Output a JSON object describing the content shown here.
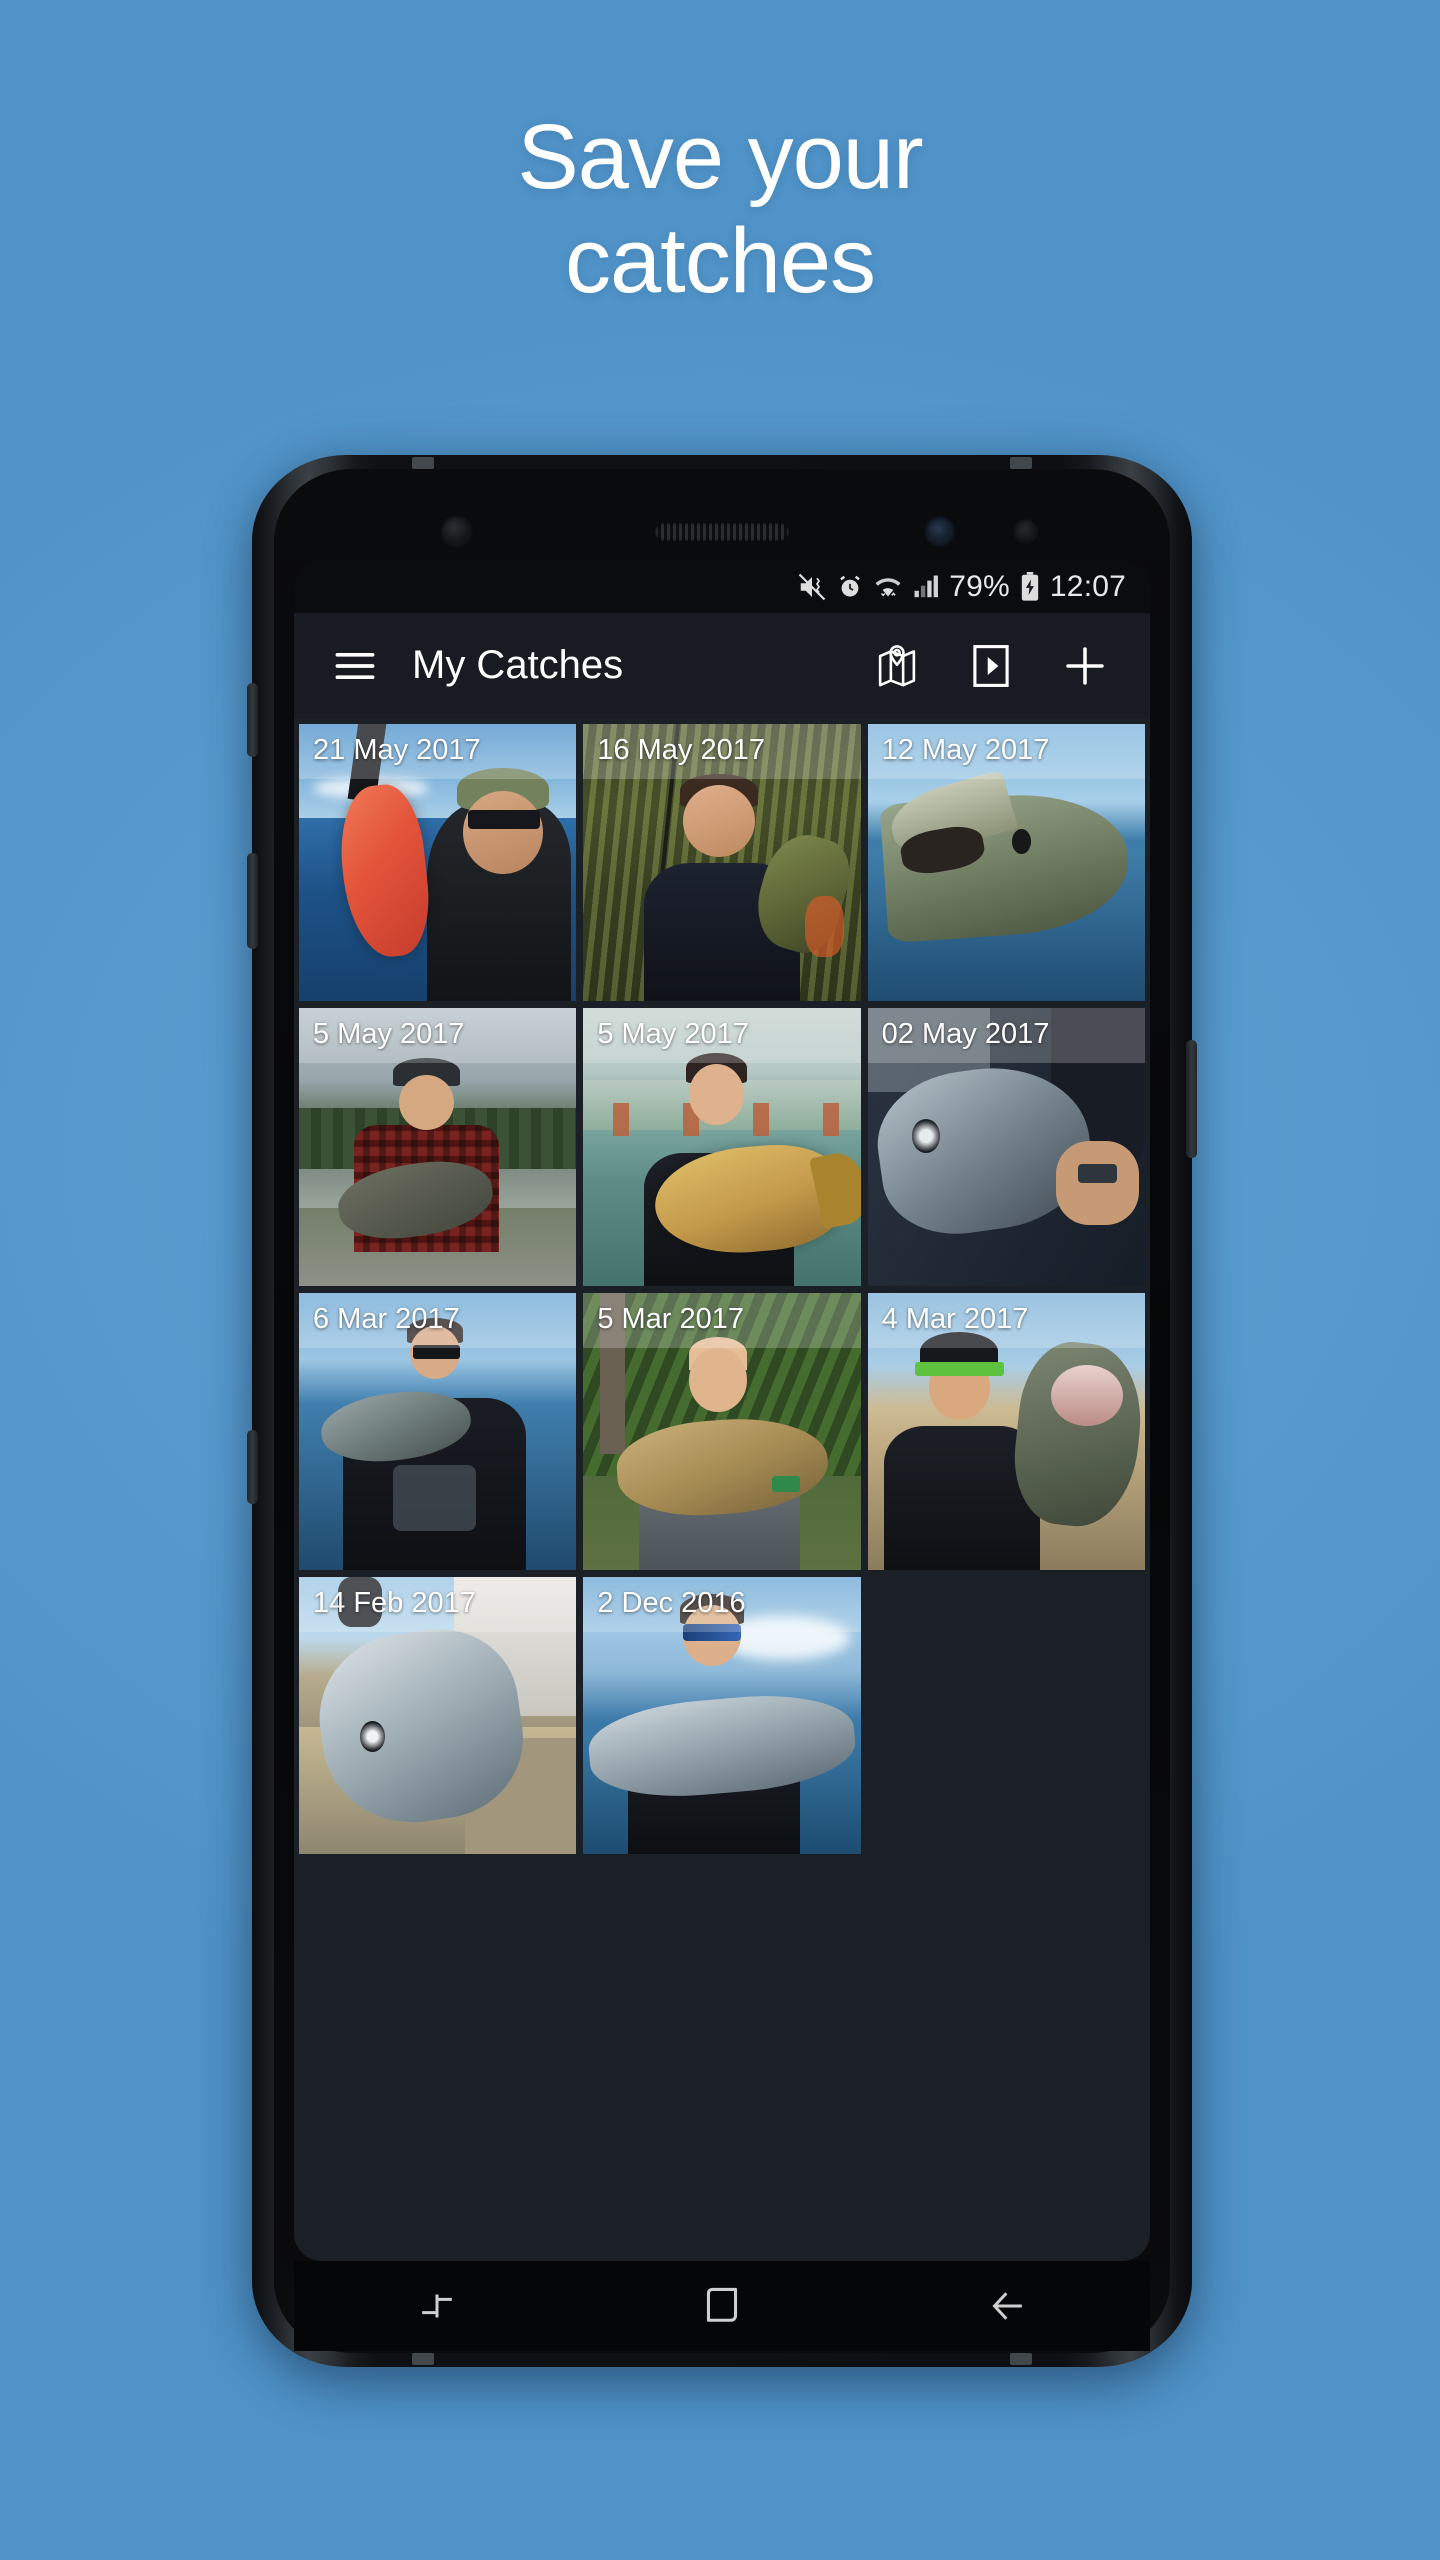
{
  "promo": {
    "headline_line1": "Save your",
    "headline_line2": "catches",
    "background_color": "#5a9ed1"
  },
  "device": {
    "frame": "samsung-galaxy-s8",
    "statusbar": {
      "icons": [
        "mute-vibrate-icon",
        "alarm-icon",
        "wifi-icon",
        "signal-icon",
        "battery-charging-icon"
      ],
      "battery_percent": "79%",
      "time": "12:07"
    },
    "navbar": {
      "recents_label": "recents-icon",
      "home_label": "home-icon",
      "back_label": "back-icon"
    }
  },
  "app": {
    "appbar": {
      "menu_icon": "hamburger-menu-icon",
      "title": "My Catches",
      "actions": [
        {
          "name": "map-icon",
          "label": "Map"
        },
        {
          "name": "slideshow-icon",
          "label": "Slideshow"
        },
        {
          "name": "add-icon",
          "label": "Add catch"
        }
      ]
    },
    "grid": {
      "background_color": "#1b1f26",
      "catches": [
        {
          "date": "21 May 2017",
          "art": "p1"
        },
        {
          "date": "16 May 2017",
          "art": "p2"
        },
        {
          "date": "12 May 2017",
          "art": "p3"
        },
        {
          "date": "5 May 2017",
          "art": "p4"
        },
        {
          "date": "5 May 2017",
          "art": "p5"
        },
        {
          "date": "02 May 2017",
          "art": "p6"
        },
        {
          "date": "6 Mar 2017",
          "art": "p7"
        },
        {
          "date": "5 Mar 2017",
          "art": "p8"
        },
        {
          "date": "4 Mar 2017",
          "art": "p9"
        },
        {
          "date": "14 Feb 2017",
          "art": "p10"
        },
        {
          "date": "2 Dec 2016",
          "art": "p11"
        }
      ]
    }
  }
}
